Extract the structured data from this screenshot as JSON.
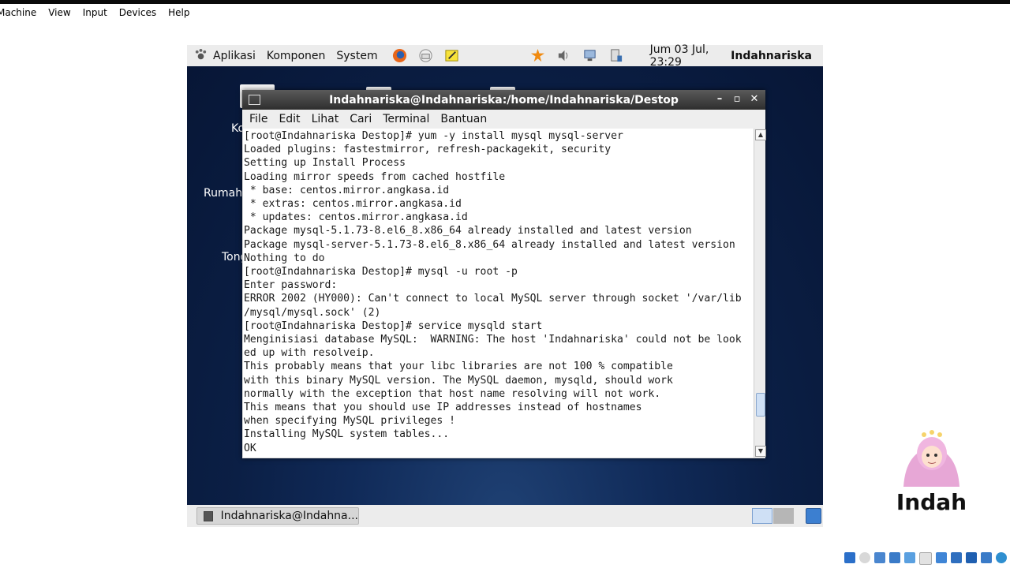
{
  "vbox_menu": [
    "Machine",
    "View",
    "Input",
    "Devices",
    "Help"
  ],
  "guest_panel": {
    "menus": [
      "Aplikasi",
      "Komponen",
      "System"
    ],
    "clock": "Jum 03 Jul, 23:29",
    "user": "Indahnariska",
    "icons": [
      "firefox-icon",
      "mail-icon",
      "notes-icon",
      "update-icon",
      "volume-icon",
      "network-icon",
      "printer-icon"
    ]
  },
  "desktop_labels": [
    "Ko",
    "Rumah",
    "Tong"
  ],
  "terminal": {
    "title": "Indahnariska@Indahnariska:/home/Indahnariska/Destop",
    "menu": [
      "File",
      "Edit",
      "Lihat",
      "Cari",
      "Terminal",
      "Bantuan"
    ],
    "lines": [
      "[root@Indahnariska Destop]# yum -y install mysql mysql-server",
      "Loaded plugins: fastestmirror, refresh-packagekit, security",
      "Setting up Install Process",
      "Loading mirror speeds from cached hostfile",
      " * base: centos.mirror.angkasa.id",
      " * extras: centos.mirror.angkasa.id",
      " * updates: centos.mirror.angkasa.id",
      "Package mysql-5.1.73-8.el6_8.x86_64 already installed and latest version",
      "Package mysql-server-5.1.73-8.el6_8.x86_64 already installed and latest version",
      "Nothing to do",
      "[root@Indahnariska Destop]# mysql -u root -p",
      "Enter password:",
      "ERROR 2002 (HY000): Can't connect to local MySQL server through socket '/var/lib",
      "/mysql/mysql.sock' (2)",
      "[root@Indahnariska Destop]# service mysqld start",
      "Menginisiasi database MySQL:  WARNING: The host 'Indahnariska' could not be look",
      "ed up with resolveip.",
      "This probably means that your libc libraries are not 100 % compatible",
      "with this binary MySQL version. The MySQL daemon, mysqld, should work",
      "normally with the exception that host name resolving will not work.",
      "This means that you should use IP addresses instead of hostnames",
      "when specifying MySQL privileges !",
      "Installing MySQL system tables...",
      "OK"
    ]
  },
  "taskbar": {
    "task_label": "Indahnariska@Indahna..."
  },
  "watermark": {
    "text": "Indah"
  },
  "colors": {
    "accent": "#3c7fd0",
    "desktop": "#0b1f45"
  }
}
